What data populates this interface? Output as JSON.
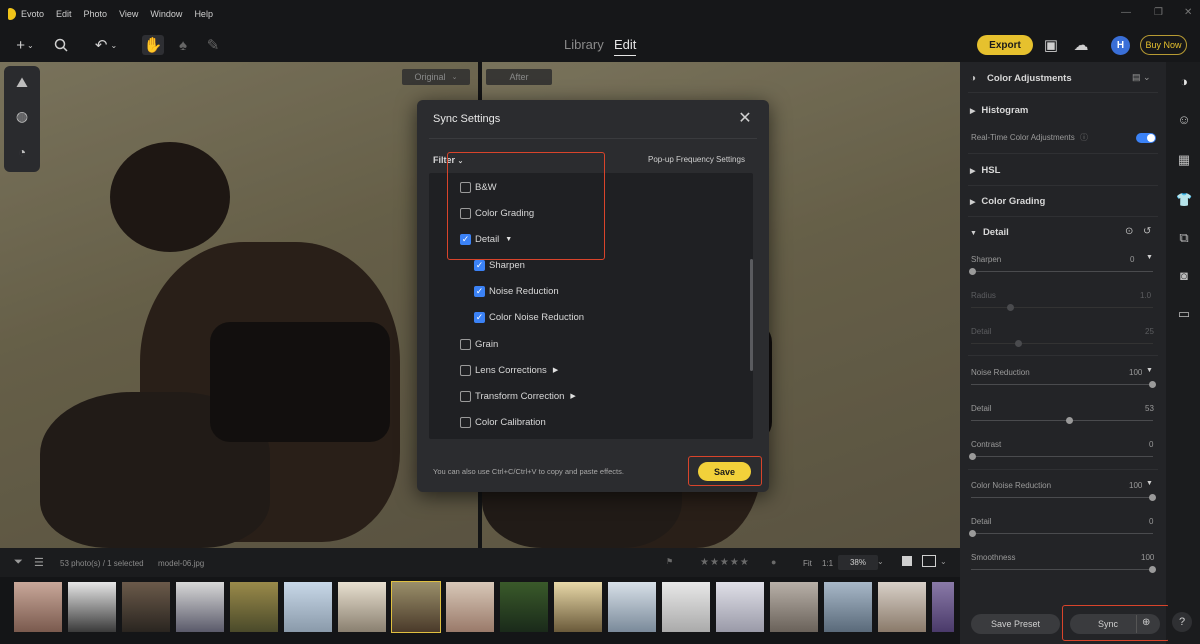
{
  "menubar": {
    "app_name": "Evoto",
    "items": [
      "Edit",
      "Photo",
      "View",
      "Window",
      "Help"
    ]
  },
  "toolbar": {
    "view_library": "Library",
    "view_edit": "Edit",
    "export_label": "Export",
    "avatar_initial": "H",
    "buy_now_label": "Buy Now"
  },
  "canvas": {
    "original_label": "Original",
    "after_label": "After"
  },
  "dialog": {
    "title": "Sync Settings",
    "filter_label": "Filter",
    "popup_frequency_label": "Pop-up Frequency Settings",
    "items": [
      {
        "label": "B&W",
        "checked": false
      },
      {
        "label": "Color Grading",
        "checked": false
      },
      {
        "label": "Detail",
        "checked": true
      },
      {
        "label": "Sharpen",
        "checked": true
      },
      {
        "label": "Noise Reduction",
        "checked": true
      },
      {
        "label": "Color Noise Reduction",
        "checked": true
      },
      {
        "label": "Grain",
        "checked": false
      },
      {
        "label": "Lens Corrections",
        "checked": false
      },
      {
        "label": "Transform Correction",
        "checked": false
      },
      {
        "label": "Color Calibration",
        "checked": false
      }
    ],
    "note": "You can also use Ctrl+C/Ctrl+V to copy and paste effects.",
    "save_label": "Save"
  },
  "strip": {
    "photo_count": "53 photo(s) / 1 selected",
    "filename": "model-06.jpg",
    "fit_label": "Fit",
    "one_to_one_label": "1:1",
    "zoom": "38%"
  },
  "panel": {
    "title": "Color Adjustments",
    "histogram": "Histogram",
    "realtime_label": "Real-Time Color Adjustments",
    "realtime_on": true,
    "hsl": "HSL",
    "color_grading": "Color Grading",
    "detail": "Detail",
    "sharpen": {
      "label": "Sharpen",
      "value": "0"
    },
    "radius": {
      "label": "Radius",
      "value": "1.0"
    },
    "detail_sharpen": {
      "label": "Detail",
      "value": "25"
    },
    "noise_reduction": {
      "label": "Noise Reduction",
      "value": "100"
    },
    "nr_detail": {
      "label": "Detail",
      "value": "53"
    },
    "nr_contrast": {
      "label": "Contrast",
      "value": "0"
    },
    "color_noise_reduction": {
      "label": "Color Noise Reduction",
      "value": "100"
    },
    "cnr_detail": {
      "label": "Detail",
      "value": "0"
    },
    "cnr_smoothness": {
      "label": "Smoothness",
      "value": "100"
    },
    "save_preset_label": "Save Preset",
    "sync_label": "Sync",
    "help_label": "?"
  },
  "colors": {
    "accent": "#3b82f6",
    "export": "#e6c12e",
    "save": "#f2d13a",
    "highlight": "#d9442b"
  }
}
